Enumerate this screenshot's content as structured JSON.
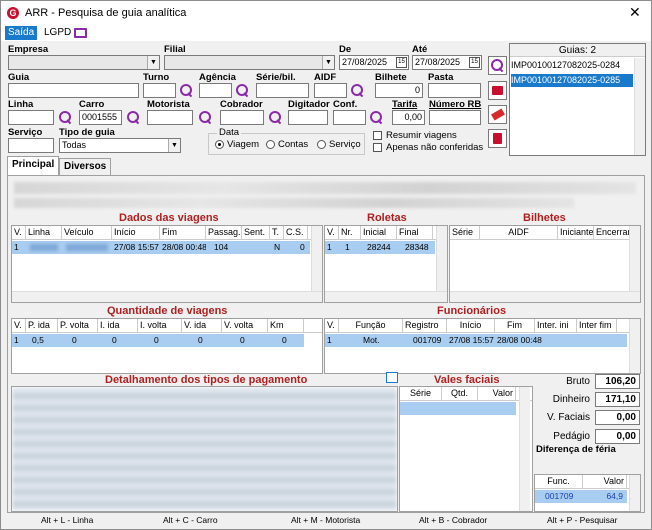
{
  "window": {
    "title": "ARR - Pesquisa de guia analítica",
    "close": "✕"
  },
  "menu": [
    {
      "label": "Saída"
    },
    {
      "label": "LGPD"
    }
  ],
  "filters": {
    "empresa_label": "Empresa",
    "filial_label": "Filial",
    "de_label": "De",
    "ate_label": "Até",
    "de_value": "27/08/2025",
    "ate_value": "27/08/2025",
    "guia_label": "Guia",
    "turno_label": "Turno",
    "agencia_label": "Agência",
    "serie_label": "Série/bil.",
    "aidf_label": "AIDF",
    "bilhete_label": "Bilhete",
    "bilhete_value": "0",
    "pasta_label": "Pasta",
    "linha_label": "Linha",
    "carro_label": "Carro",
    "carro_value": "0001555",
    "motorista_label": "Motorista",
    "cobrador_label": "Cobrador",
    "digitador_label": "Digitador",
    "conf_label": "Conf.",
    "tarifa_label": "Tarifa",
    "tarifa_value": "0,00",
    "numero_rb_label": "Número RB",
    "servico_label": "Serviço",
    "tipo_guia_label": "Tipo de guia",
    "tipo_guia_value": "Todas",
    "data_group_label": "Data",
    "radio_viagem": "Viagem",
    "radio_contas": "Contas",
    "radio_servico": "Serviço",
    "chk_resumir": "Resumir viagens",
    "chk_apenas": "Apenas não conferidas"
  },
  "guias": {
    "header": "Guias: 2",
    "items": [
      "IMP00100127082025-0284",
      "IMP00100127082025-0285"
    ],
    "selected_index": 1
  },
  "tabs": [
    {
      "label": "Principal"
    },
    {
      "label": "Diversos"
    }
  ],
  "dados_viagens": {
    "title": "Dados das viagens",
    "columns": [
      "V.",
      "Linha",
      "Veículo",
      "Início",
      "Fim",
      "Passag.",
      "Sent.",
      "T.",
      "C.S."
    ],
    "row": [
      "1",
      "",
      "",
      "27/08 15:57",
      "28/08 00:48",
      "104",
      "",
      "N",
      "0"
    ]
  },
  "roletas": {
    "title": "Roletas",
    "columns": [
      "V.",
      "Nr.",
      "Inicial",
      "Final"
    ],
    "row": [
      "1",
      "1",
      "28244",
      "28348"
    ]
  },
  "bilhetes": {
    "title": "Bilhetes",
    "columns": [
      "Série",
      "AIDF",
      "Iniciante",
      "Encerran"
    ]
  },
  "quantidade": {
    "title": "Quantidade de viagens",
    "columns": [
      "V.",
      "P. ida",
      "P. volta",
      "I. ida",
      "I. volta",
      "V. ida",
      "V. volta",
      "Km"
    ],
    "row": [
      "1",
      "0,5",
      "0",
      "0",
      "0",
      "0",
      "0",
      "0"
    ]
  },
  "funcionarios": {
    "title": "Funcionários",
    "columns": [
      "V.",
      "Função",
      "Registro",
      "Início",
      "Fim",
      "Inter. ini",
      "Inter fim"
    ],
    "row": [
      "1",
      "Mot.",
      "001709",
      "27/08 15:57",
      "28/08 00:48",
      "",
      ""
    ]
  },
  "pagamento": {
    "title": "Detalhamento dos tipos de pagamento"
  },
  "vales": {
    "title": "Vales faciais",
    "columns": [
      "Série",
      "Qtd.",
      "Valor"
    ]
  },
  "totais": {
    "bruto_label": "Bruto",
    "bruto_value": "106,20",
    "dinheiro_label": "Dinheiro",
    "dinheiro_value": "171,10",
    "vfaciais_label": "V. Faciais",
    "vfaciais_value": "0,00",
    "pedagio_label": "Pedágio",
    "pedagio_value": "0,00",
    "diferenca_label": "Diferença de féria",
    "func_header": "Func.",
    "valor_header": "Valor",
    "func_value": "001709",
    "valor_value": "64,9"
  },
  "status_bar": [
    "Alt + L - Linha",
    "Alt + C - Carro",
    "Alt + M - Motorista",
    "Alt + B - Cobrador",
    "Alt + P - Pesquisar"
  ]
}
